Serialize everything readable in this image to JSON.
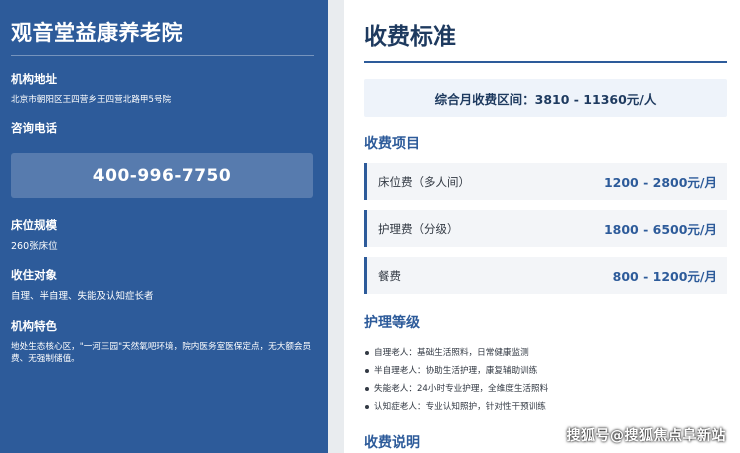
{
  "org": {
    "name": "观音堂益康养老院",
    "address_label": "机构地址",
    "address": "北京市朝阳区王四营乡王四营北路甲5号院",
    "phone_label": "咨询电话",
    "phone": "400-996-7750",
    "beds_label": "床位规模",
    "beds": "260张床位",
    "target_label": "收住对象",
    "target": "自理、半自理、失能及认知症长者",
    "features_label": "机构特色",
    "features": "地处生态核心区，\"一河三园\"天然氧吧环境，院内医务室医保定点，无大额会员费、无强制储值。"
  },
  "fees": {
    "title": "收费标准",
    "summary": "综合月收费区间：3810 - 11360元/人",
    "items_heading": "收费项目",
    "items": [
      {
        "name": "床位费（多人间）",
        "price": "1200 - 2800元/月"
      },
      {
        "name": "护理费（分级）",
        "price": "1800 - 6500元/月"
      },
      {
        "name": "餐费",
        "price": "800 - 1200元/月"
      }
    ],
    "care_heading": "护理等级",
    "care_levels": [
      "自理老人：基础生活照料，日常健康监测",
      "半自理老人：协助生活护理，康复辅助训练",
      "失能老人：24小时专业护理，全维度生活照料",
      "认知症老人：专业认知照护，针对性干预训练"
    ],
    "notes_heading": "收费说明"
  },
  "watermark": "搜狐号@搜狐焦点阜新站"
}
